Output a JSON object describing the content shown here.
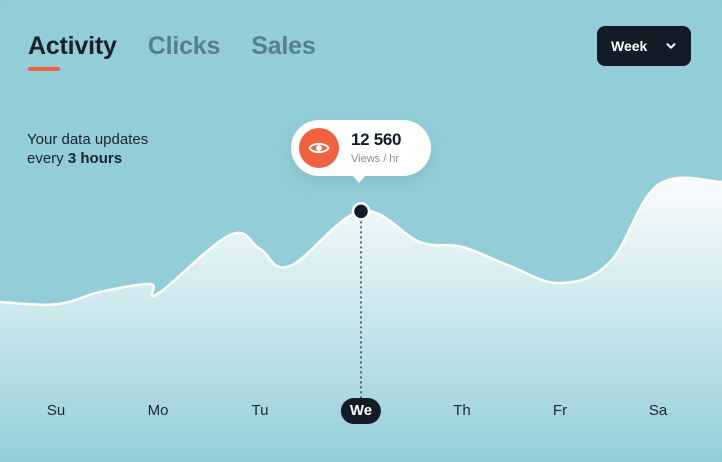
{
  "tabs": [
    {
      "label": "Activity",
      "active": true
    },
    {
      "label": "Clicks",
      "active": false
    },
    {
      "label": "Sales",
      "active": false
    }
  ],
  "period_select": {
    "value": "Week",
    "icon": "chevron-down-icon"
  },
  "info": {
    "line1": "Your data updates",
    "line2_prefix": "every ",
    "line2_bold": "3 hours"
  },
  "tooltip": {
    "value": "12 560",
    "unit": "Views / hr",
    "icon": "eye-icon"
  },
  "days": [
    "Su",
    "Mo",
    "Tu",
    "We",
    "Th",
    "Fr",
    "Sa"
  ],
  "selected_day": "We",
  "colors": {
    "background": "#93ced8",
    "accent": "#f0613f",
    "dark": "#131b26"
  },
  "chart_data": {
    "type": "area",
    "x": [
      "Su",
      "Mo",
      "Tu",
      "We",
      "Th",
      "Fr",
      "Sa"
    ],
    "series": [
      {
        "values": [
          8200,
          8700,
          10800,
          12560,
          10900,
          9200,
          13800
        ]
      }
    ],
    "selected": {
      "x": "We",
      "y": 12560
    },
    "grid": false,
    "axes_visible": false
  }
}
